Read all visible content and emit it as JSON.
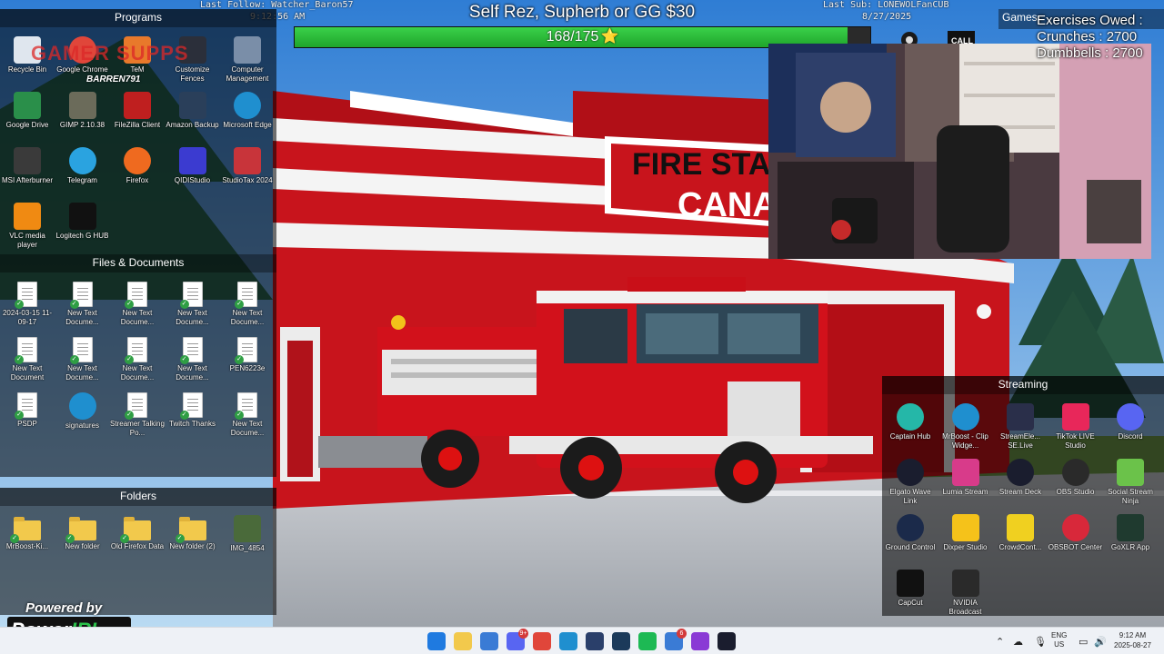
{
  "overlay": {
    "last_follow": "Last Follow: Watcher_Baron57",
    "time": "9:12:56 AM",
    "last_sub": "Last Sub: LONEWOLFanCUB",
    "date": "8/27/2025",
    "goal_title": "Self Rez, Supherb or GG $30",
    "goal_current": 168,
    "goal_total": 175,
    "goal_text": "168/175",
    "goal_star": "⭐",
    "exercises_title": "Exercises Owed :",
    "crunches": "Crunches : 2700",
    "dumbbells": "Dumbbells : 2700",
    "gamer_logo": "GAMER SUPPS",
    "barren_tag": "BARREN791",
    "powered_by": "Powered by",
    "powerirl_a": "Power",
    "powerirl_b": "IRL"
  },
  "wallpaper": {
    "sign_line1": "FIRE STA",
    "sign_line2": "CANA"
  },
  "fences": {
    "programs": {
      "title": "Programs",
      "items": [
        {
          "label": "Recycle Bin",
          "icon": "recycle-bin-icon",
          "color": "#dfe6ee"
        },
        {
          "label": "Google Chrome",
          "icon": "chrome-icon",
          "color": "#e0463a"
        },
        {
          "label": "TeM",
          "icon": "app-icon",
          "color": "#e8792b"
        },
        {
          "label": "Customize Fences",
          "icon": "fences-icon",
          "color": "#2b2f3a"
        },
        {
          "label": "Computer Management",
          "icon": "computer-management-icon",
          "color": "#7a8ea8"
        },
        {
          "label": "Google Drive",
          "icon": "google-drive-icon",
          "color": "#2a8f4a"
        },
        {
          "label": "GIMP 2.10.38",
          "icon": "gimp-icon",
          "color": "#6b6b5a"
        },
        {
          "label": "FileZilla Client",
          "icon": "filezilla-icon",
          "color": "#bf1f1f"
        },
        {
          "label": "Amazon Backup",
          "icon": "amazon-photos-icon",
          "color": "#2a3f5a"
        },
        {
          "label": "Microsoft Edge",
          "icon": "edge-icon",
          "color": "#1f8fcf"
        },
        {
          "label": "MSI Afterburner",
          "icon": "msi-afterburner-icon",
          "color": "#3a3a3a"
        },
        {
          "label": "Telegram",
          "icon": "telegram-icon",
          "color": "#2aa3e0"
        },
        {
          "label": "Firefox",
          "icon": "firefox-icon",
          "color": "#ef6a1f"
        },
        {
          "label": "QIDIStudio",
          "icon": "qidistudio-icon",
          "color": "#3b3bd0"
        },
        {
          "label": "StudioTax 2024",
          "icon": "studiotax-icon",
          "color": "#c8343a"
        },
        {
          "label": "VLC media player",
          "icon": "vlc-icon",
          "color": "#f08a12"
        },
        {
          "label": "Logitech G HUB",
          "icon": "logitech-g-icon",
          "color": "#111111"
        }
      ]
    },
    "files": {
      "title": "Files & Documents",
      "items": [
        {
          "label": "2024-03-15 11-09-17",
          "kind": "doc"
        },
        {
          "label": "New Text Docume...",
          "kind": "doc"
        },
        {
          "label": "New Text Docume...",
          "kind": "doc"
        },
        {
          "label": "New Text Docume...",
          "kind": "doc"
        },
        {
          "label": "New Text Docume...",
          "kind": "doc"
        },
        {
          "label": "New Text Document",
          "kind": "doc"
        },
        {
          "label": "New Text Docume...",
          "kind": "doc"
        },
        {
          "label": "New Text Docume...",
          "kind": "doc"
        },
        {
          "label": "New Text Docume...",
          "kind": "doc"
        },
        {
          "label": "PEN6223e",
          "kind": "doc"
        },
        {
          "label": "PSDP",
          "kind": "doc"
        },
        {
          "label": "signatures",
          "kind": "edge"
        },
        {
          "label": "Streamer Talking Po...",
          "kind": "doc"
        },
        {
          "label": "Twitch Thanks",
          "kind": "doc"
        },
        {
          "label": "New Text Docume...",
          "kind": "doc"
        }
      ]
    },
    "folders": {
      "title": "Folders",
      "items": [
        {
          "label": "MrBoost-Ki...",
          "kind": "folder"
        },
        {
          "label": "New folder",
          "kind": "folder"
        },
        {
          "label": "Old Firefox Data",
          "kind": "folder"
        },
        {
          "label": "New folder (2)",
          "kind": "folder"
        },
        {
          "label": "IMG_4854",
          "kind": "image"
        }
      ]
    },
    "games": {
      "title": "Games"
    },
    "streaming": {
      "title": "Streaming",
      "items": [
        {
          "label": "Captain Hub",
          "icon": "captain-hub-icon",
          "color": "#25b7a8"
        },
        {
          "label": "MrBoost - Clip Widge...",
          "icon": "edge-icon",
          "color": "#1f8fcf"
        },
        {
          "label": "StreamEle... SE.Live",
          "icon": "streamelements-icon",
          "color": "#2a2f4a"
        },
        {
          "label": "TikTok LIVE Studio",
          "icon": "tiktok-icon",
          "color": "#e8275a"
        },
        {
          "label": "Discord",
          "icon": "discord-icon",
          "color": "#5865f2"
        },
        {
          "label": "Elgato Wave Link",
          "icon": "wave-link-icon",
          "color": "#1a1d2e"
        },
        {
          "label": "Lumia Stream",
          "icon": "lumia-stream-icon",
          "color": "#d83b8a"
        },
        {
          "label": "Stream Deck",
          "icon": "stream-deck-icon",
          "color": "#1a1d2e"
        },
        {
          "label": "OBS Studio",
          "icon": "obs-icon",
          "color": "#2a2a2a"
        },
        {
          "label": "Social Stream Ninja",
          "icon": "social-stream-icon",
          "color": "#6bc24a"
        },
        {
          "label": "Ground Control",
          "icon": "ground-control-icon",
          "color": "#1b2a4a"
        },
        {
          "label": "Dixper Studio",
          "icon": "dixper-icon",
          "color": "#f5c21a"
        },
        {
          "label": "CrowdCont...",
          "icon": "crowd-control-icon",
          "color": "#f0d020"
        },
        {
          "label": "OBSBOT Center",
          "icon": "obsbot-icon",
          "color": "#d8283a"
        },
        {
          "label": "GoXLR App",
          "icon": "goxlr-icon",
          "color": "#1f3a2f"
        },
        {
          "label": "CapCut",
          "icon": "capcut-icon",
          "color": "#111111"
        },
        {
          "label": "NVIDIA Broadcast",
          "icon": "nvidia-icon",
          "color": "#2a2a2a"
        }
      ]
    }
  },
  "taskbar": {
    "apps": [
      {
        "name": "start-icon",
        "color": "#1f7ae0"
      },
      {
        "name": "file-explorer-icon",
        "color": "#f2c94c"
      },
      {
        "name": "store-icon",
        "color": "#3a7bd5"
      },
      {
        "name": "discord-taskbar-icon",
        "color": "#5865f2",
        "badge": "9+"
      },
      {
        "name": "chrome-taskbar-icon",
        "color": "#e0463a"
      },
      {
        "name": "edge-taskbar-icon",
        "color": "#1f8fcf"
      },
      {
        "name": "stream-deck-taskbar-icon",
        "color": "#2a3f6a"
      },
      {
        "name": "steam-taskbar-icon",
        "color": "#1b3a5a"
      },
      {
        "name": "spotify-taskbar-icon",
        "color": "#1db954"
      },
      {
        "name": "app-taskbar-icon",
        "color": "#3a7bd5",
        "badge": "6"
      },
      {
        "name": "social-stream-taskbar-icon",
        "color": "#8a3ad5"
      },
      {
        "name": "arrow-taskbar-icon",
        "color": "#1a1d2e"
      }
    ],
    "lang_top": "ENG",
    "lang_bottom": "US",
    "clock_time": "9:12 AM",
    "clock_date": "2025-08-27"
  }
}
